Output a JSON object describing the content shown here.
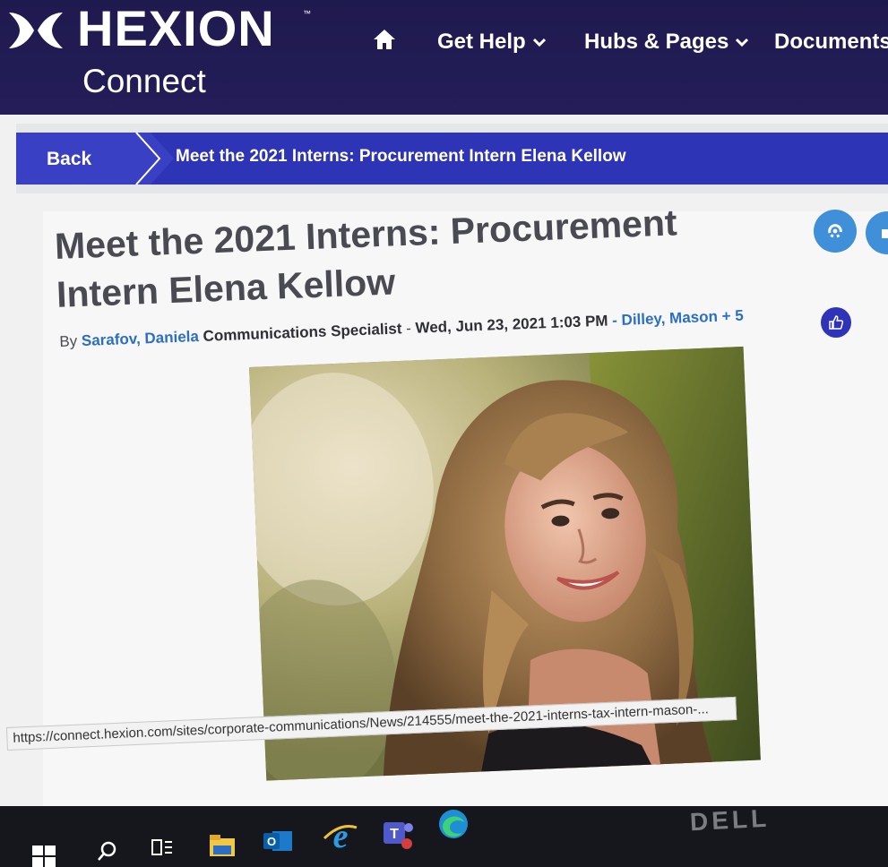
{
  "header": {
    "logo_word": "HEXION",
    "logo_tm": "™",
    "logo_sub": "Connect",
    "nav": [
      {
        "label": "Get Help",
        "has_dropdown": true
      },
      {
        "label": "Hubs & Pages",
        "has_dropdown": true
      },
      {
        "label": "Documents",
        "has_dropdown": false
      }
    ],
    "home_icon": "home-icon"
  },
  "breadcrumb": {
    "back_label": "Back",
    "current": "Meet the 2021 Interns: Procurement Intern Elena Kellow"
  },
  "article": {
    "title": "Meet the 2021 Interns: Procurement Intern Elena Kellow",
    "byline": {
      "by": "By",
      "author": "Sarafov, Daniela",
      "role": "Communications Specialist",
      "sep1": " - ",
      "date": "Wed, Jun 23, 2021 1:03 PM",
      "sep2": " - ",
      "likers": "Dilley, Mason + 5"
    },
    "photo_alt": "Portrait of intern with long wavy hair, smiling"
  },
  "status_bar": {
    "url": "https://connect.hexion.com/sites/corporate-communications/News/214555/meet-the-2021-interns-tax-intern-mason-..."
  },
  "taskbar": {
    "icons": [
      "windows-start-icon",
      "search-icon",
      "task-view-icon",
      "file-explorer-icon",
      "outlook-icon",
      "internet-explorer-icon",
      "teams-icon",
      "edge-icon"
    ]
  },
  "monitor_brand": "DELL",
  "colors": {
    "header_bg": "#241d59",
    "breadcrumb_bg": "#2e34b6",
    "link": "#2b6fc4",
    "action_button": "#3f8fd9",
    "like_button": "#2f33b8"
  }
}
